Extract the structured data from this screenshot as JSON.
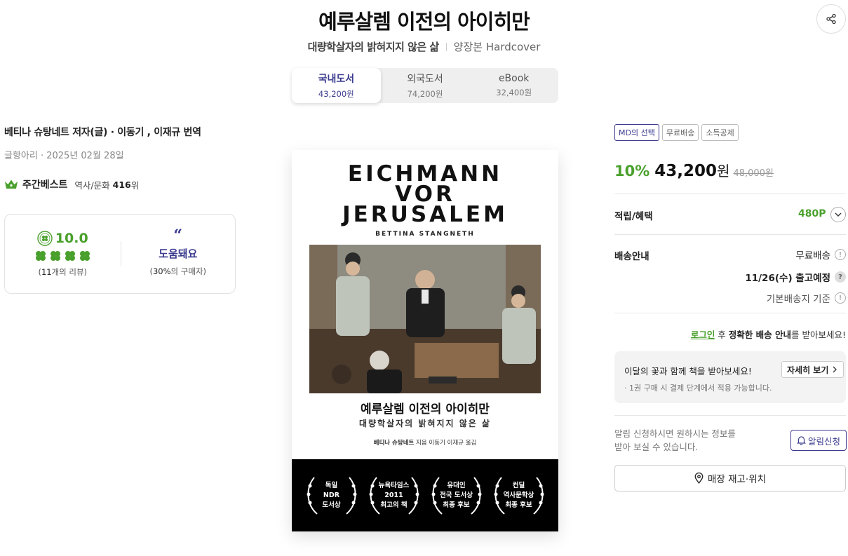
{
  "header": {
    "title": "예루살렘 이전의 아이히만",
    "subtitle": "대량학살자의 밝혀지지 않은 삶",
    "binding": "양장본 Hardcover"
  },
  "formats": [
    {
      "label": "국내도서",
      "price": "43,200원",
      "active": true
    },
    {
      "label": "외국도서",
      "price": "74,200원",
      "active": false
    },
    {
      "label": "eBook",
      "price": "32,400원",
      "active": false
    }
  ],
  "info": {
    "author_line": "베티나 슈탕네트 저자(글) · 이동기 , 이재규 번역",
    "publisher_line": "글항아리 · 2025년 02월 28일",
    "best_label": "주간베스트",
    "best_category": "역사/문화",
    "best_rank": "416",
    "best_rank_suffix": "위"
  },
  "review": {
    "score": "10.0",
    "count_open": "(",
    "count_num": "11",
    "count_suffix": "개의 리뷰)",
    "helpful_label": "도움돼요",
    "helpful_open": "(",
    "helpful_pct": "30%",
    "helpful_suffix": "의 구매자)"
  },
  "cover": {
    "title_line1": "EICHMANN",
    "title_line2": "VOR",
    "title_line3": "JERUSALEM",
    "author_en": "BETTINA STANGNETH",
    "ko_title": "예루살렘 이전의 아이히만",
    "ko_subtitle": "대량학살자의 밝혀지지 않은 삶",
    "credit_name": "베티나 슈탕네트",
    "credit_rest": " 지음  이동기 이재규 옮김",
    "awards": [
      "독일\nNDR\n도서상",
      "뉴욕타임스\n2011\n최고의 책",
      "유대인\n전국 도서상\n최종 후보",
      "컨딜\n역사문학상\n최종 후보"
    ]
  },
  "price": {
    "badges": [
      "MD의 선택",
      "무료배송",
      "소득공제"
    ],
    "discount": "10%",
    "sale": "43,200",
    "won": "원",
    "original": "48,000원"
  },
  "benefits": {
    "label": "적립/혜택",
    "points": "480P"
  },
  "shipping": {
    "label": "배송안내",
    "free": "무료배송",
    "date": "11/26(수) 출고예정",
    "base": "기본배송지 기준",
    "login_link": "로그인",
    "login_mid": " 후 ",
    "login_bold": "정확한 배송 안내",
    "login_end": "를 받아보세요!"
  },
  "promo": {
    "main": "이달의 꽃과 함께 책을 받아보세요!",
    "sub": "· 1권 구매 시 결제 단계에서 적용 가능합니다.",
    "button": "자세히 보기"
  },
  "alarm": {
    "text_line1": "알림 신청하시면 원하시는 정보를",
    "text_line2": "받아 보실 수 있습니다.",
    "button": "알림신청"
  },
  "store": {
    "button": "매장 재고·위치"
  },
  "colors": {
    "accent_green": "#4aa02c",
    "accent_navy": "#3b3b8f"
  }
}
